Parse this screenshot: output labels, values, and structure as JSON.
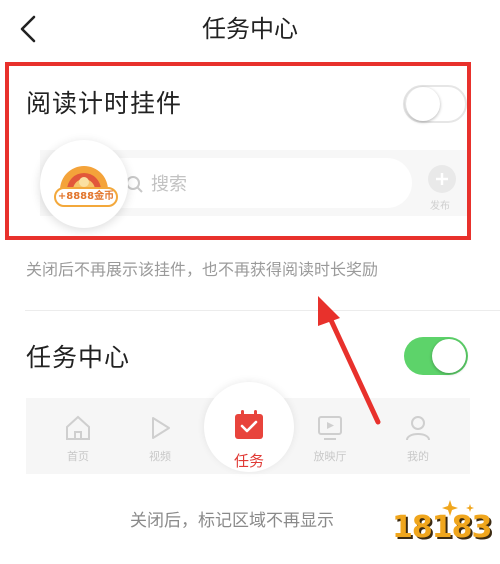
{
  "header": {
    "title": "任务中心",
    "back_icon": "chevron-left-icon"
  },
  "reading_widget": {
    "label": "阅读计时挂件",
    "toggle_state": "off",
    "coin_badge": "+8888金币",
    "search_placeholder": "搜索",
    "plus_label": "发布",
    "highlight_color": "#e8312c"
  },
  "reading_widget_desc": "关闭后不再展示该挂件，也不再获得阅读时长奖励",
  "task_center": {
    "label": "任务中心",
    "toggle_state": "on",
    "toggle_color": "#5dd36a"
  },
  "tabbar": {
    "tabs": [
      {
        "label": "首页",
        "icon": "home-icon"
      },
      {
        "label": "视频",
        "icon": "play-icon"
      },
      {
        "label": "任务",
        "icon": "calendar-check-icon"
      },
      {
        "label": "放映厅",
        "icon": "video-screen-icon"
      },
      {
        "label": "我的",
        "icon": "user-icon"
      }
    ],
    "accent_color": "#e03a35"
  },
  "footer_desc": "关闭后，标记区域不再显示",
  "watermark": "18183"
}
